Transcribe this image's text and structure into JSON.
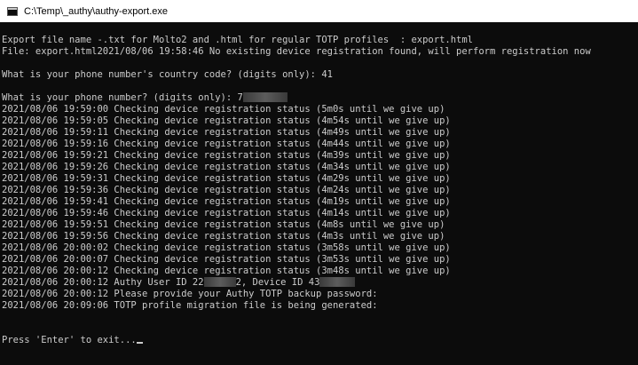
{
  "window": {
    "title": "C:\\Temp\\_authy\\authy-export.exe"
  },
  "console": {
    "header": {
      "export_line": "Export file name -.txt for Molto2 and .html for regular TOTP profiles  : export.html",
      "file_line": "File: export.html2021/08/06 19:58:46 No existing device registration found, will perform registration now"
    },
    "country_prompt": "What is your phone number's country code? (digits only): 41",
    "phone_prompt": "What is your phone number? (digits only): 7",
    "status_lines": [
      "2021/08/06 19:59:00 Checking device registration status (5m0s until we give up)",
      "2021/08/06 19:59:05 Checking device registration status (4m54s until we give up)",
      "2021/08/06 19:59:11 Checking device registration status (4m49s until we give up)",
      "2021/08/06 19:59:16 Checking device registration status (4m44s until we give up)",
      "2021/08/06 19:59:21 Checking device registration status (4m39s until we give up)",
      "2021/08/06 19:59:26 Checking device registration status (4m34s until we give up)",
      "2021/08/06 19:59:31 Checking device registration status (4m29s until we give up)",
      "2021/08/06 19:59:36 Checking device registration status (4m24s until we give up)",
      "2021/08/06 19:59:41 Checking device registration status (4m19s until we give up)",
      "2021/08/06 19:59:46 Checking device registration status (4m14s until we give up)",
      "2021/08/06 19:59:51 Checking device registration status (4m8s until we give up)",
      "2021/08/06 19:59:56 Checking device registration status (4m3s until we give up)",
      "2021/08/06 20:00:02 Checking device registration status (3m58s until we give up)",
      "2021/08/06 20:00:07 Checking device registration status (3m53s until we give up)",
      "2021/08/06 20:00:12 Checking device registration status (3m48s until we give up)"
    ],
    "authy_user_line": {
      "prefix": "2021/08/06 20:00:12 Authy User ID 22",
      "middle": "2, Device ID 43"
    },
    "password_prompt": "2021/08/06 20:00:12 Please provide your Authy TOTP backup password:",
    "migration_line": "2021/08/06 20:09:06 TOTP profile migration file is being generated:",
    "exit_prompt": "Press 'Enter' to exit..."
  }
}
